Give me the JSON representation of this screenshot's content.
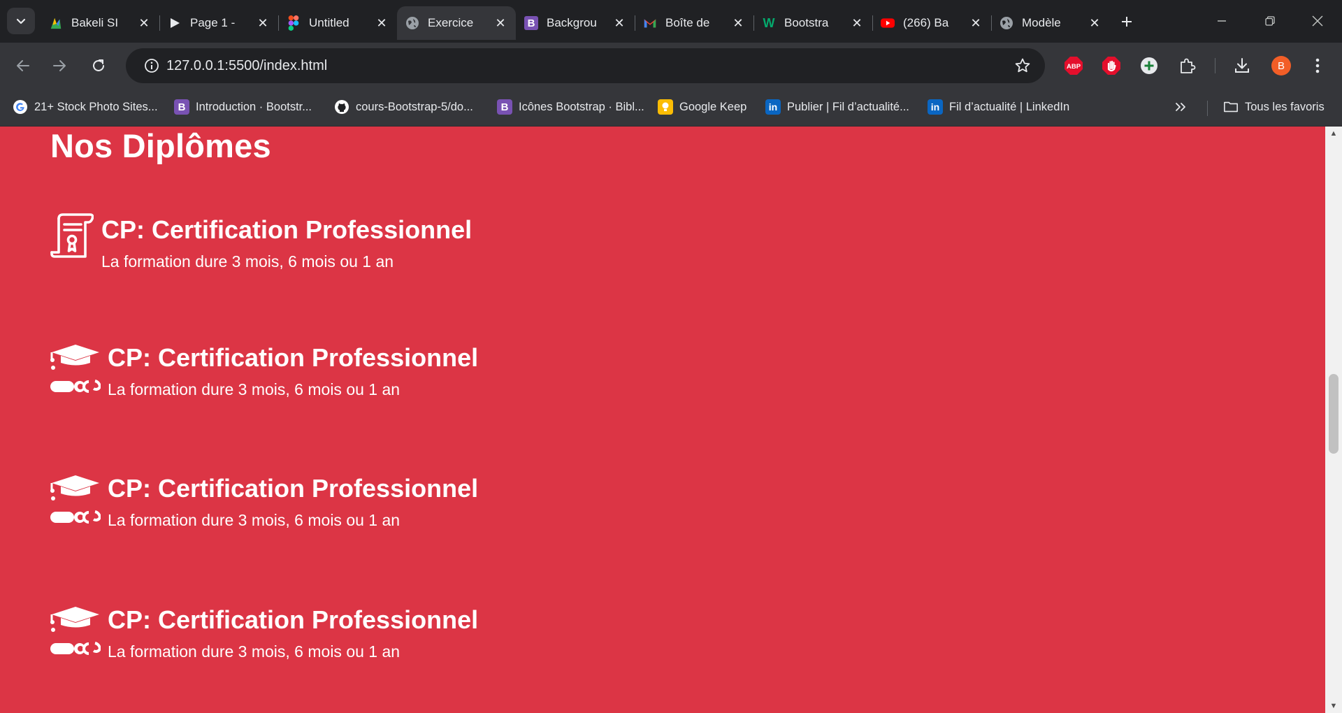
{
  "browser": {
    "tabs": [
      {
        "title": "Bakeli SI",
        "favicon": "bakeli-icon",
        "active": false
      },
      {
        "title": "Page 1 -",
        "favicon": "play-icon",
        "active": false
      },
      {
        "title": "Untitled",
        "favicon": "figma-icon",
        "active": false
      },
      {
        "title": "Exercice",
        "favicon": "globe-icon",
        "active": true
      },
      {
        "title": "Backgrou",
        "favicon": "bootstrap-icon",
        "active": false
      },
      {
        "title": "Boîte de",
        "favicon": "gmail-icon",
        "active": false
      },
      {
        "title": "Bootstra",
        "favicon": "w3-icon",
        "active": false
      },
      {
        "title": "(266) Ba",
        "favicon": "youtube-icon",
        "active": false
      },
      {
        "title": "Modèle",
        "favicon": "globe-icon",
        "active": false
      }
    ],
    "url": "127.0.0.1:5500/index.html",
    "profile_initial": "B",
    "extensions": [
      "adblock-icon",
      "hand-stop-icon",
      "plus-circle-icon",
      "puzzle-icon"
    ],
    "bookmarks": [
      {
        "label": "21+ Stock Photo Sites...",
        "icon": "google-icon"
      },
      {
        "label": "Introduction · Bootstr...",
        "icon": "bootstrap-icon"
      },
      {
        "label": "cours-Bootstrap-5/do...",
        "icon": "github-icon"
      },
      {
        "label": "Icônes Bootstrap · Bibl...",
        "icon": "bootstrap-icon"
      },
      {
        "label": "Google Keep",
        "icon": "keep-icon"
      },
      {
        "label": "Publier | Fil d’actualité...",
        "icon": "linkedin-icon"
      },
      {
        "label": "Fil d’actualité | LinkedIn",
        "icon": "linkedin-icon"
      }
    ],
    "all_bookmarks_label": "Tous les favoris"
  },
  "page": {
    "heading": "Nos Diplômes",
    "items": [
      {
        "icon": "certificate-icon",
        "title": "CP: Certification Professionnel",
        "description": "La formation dure 3 mois, 6 mois ou 1 an"
      },
      {
        "icon": "graduation-cap-icon",
        "title": "CP: Certification Professionnel",
        "description": "La formation dure 3 mois, 6 mois ou 1 an"
      },
      {
        "icon": "graduation-cap-icon",
        "title": "CP: Certification Professionnel",
        "description": "La formation dure 3 mois, 6 mois ou 1 an"
      },
      {
        "icon": "graduation-cap-icon",
        "title": "CP: Certification Professionnel",
        "description": "La formation dure 3 mois, 6 mois ou 1 an"
      }
    ]
  },
  "colors": {
    "page_background": "#dc3545",
    "browser_chrome": "#35363a",
    "tabstrip": "#202124",
    "text_on_page": "#ffffff"
  }
}
